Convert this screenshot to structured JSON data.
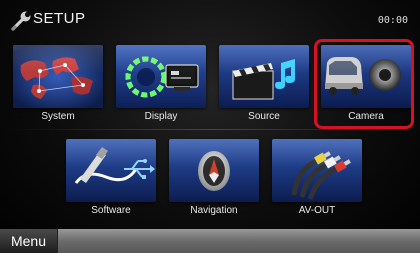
{
  "header": {
    "title": "SETUP",
    "clock": "00:00"
  },
  "tiles": [
    {
      "label": "System",
      "icon": "globe-icon"
    },
    {
      "label": "Display",
      "icon": "display-icon"
    },
    {
      "label": "Source",
      "icon": "clapperboard-icon"
    },
    {
      "label": "Camera",
      "icon": "camera-icon",
      "selected": true
    },
    {
      "label": "Software",
      "icon": "usb-icon"
    },
    {
      "label": "Navigation",
      "icon": "compass-icon"
    },
    {
      "label": "AV-OUT",
      "icon": "av-cable-icon"
    }
  ],
  "bottombar": {
    "menu_label": "Menu"
  },
  "colors": {
    "highlight": "#d51125",
    "tile_blue": "#1e3f8c"
  }
}
